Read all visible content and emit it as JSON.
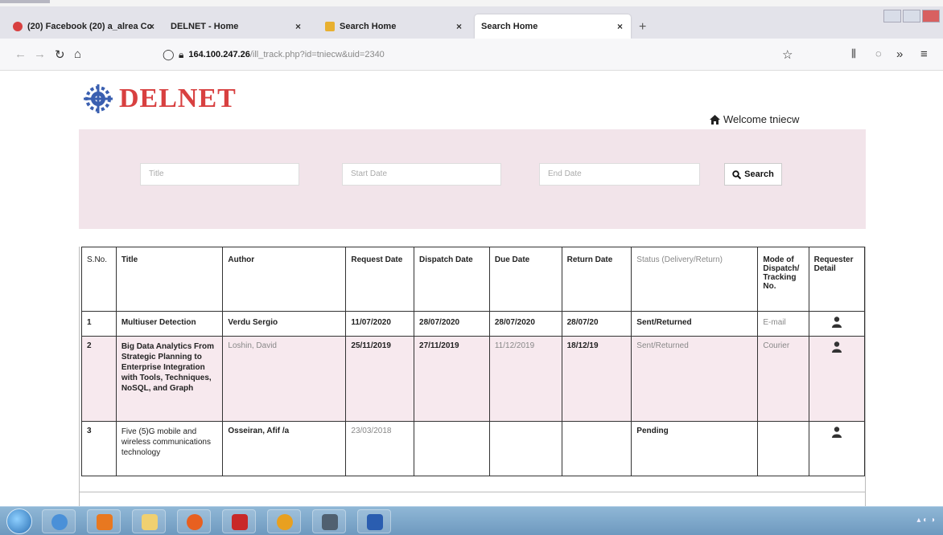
{
  "browser": {
    "tabs": [
      {
        "label": "(20) Facebook (20) a_alrea Co",
        "close": "×"
      },
      {
        "label": "DELNET - Home",
        "close": "×"
      },
      {
        "label": "Search Home",
        "close": "×"
      },
      {
        "label": "Search Home",
        "close": "×"
      }
    ],
    "new_tab": "+",
    "url_host": "164.100.247.26",
    "url_path": "/ill_track.php?id=tniecw&uid=2340"
  },
  "header": {
    "logo_text": "DELNET",
    "welcome_text": "Welcome tniecw"
  },
  "search": {
    "title_placeholder": "Title",
    "start_date_placeholder": "Start Date",
    "end_date_placeholder": "End Date",
    "button_label": "Search"
  },
  "table": {
    "headers": [
      "S.No.",
      "Title",
      "Author",
      "Request Date",
      "Dispatch Date",
      "Due Date",
      "Return Date",
      "Status (Delivery/Return)",
      "Mode of Dispatch/ Tracking No.",
      "Requester Detail"
    ],
    "rows": [
      {
        "sno": "1",
        "title": "Multiuser Detection",
        "author": "Verdu Sergio",
        "request_date": "11/07/2020",
        "dispatch_date": "28/07/2020",
        "due_date": "28/07/2020",
        "return_date": "28/07/20",
        "status": "Sent/Returned",
        "mode": "E-mail"
      },
      {
        "sno": "2",
        "title": "Big Data Analytics From Strategic Planning to Enterprise Integration with Tools, Techniques, NoSQL, and Graph",
        "author": "Loshin, David",
        "request_date": "25/11/2019",
        "dispatch_date": "27/11/2019",
        "due_date": "11/12/2019",
        "return_date": "18/12/19",
        "status": "Sent/Returned",
        "mode": "Courier"
      },
      {
        "sno": "3",
        "title": "Five (5)G mobile and wireless communications technology",
        "author": "Osseiran, Afif /a",
        "request_date": "23/03/2018",
        "dispatch_date": "",
        "due_date": "",
        "return_date": "",
        "status": "Pending",
        "mode": ""
      }
    ]
  },
  "colors": {
    "logo_red": "#d84040",
    "panel_pink": "#f2e4ea",
    "row_pink": "#f7e9ee",
    "icon_blue": "#3a5fb0"
  }
}
